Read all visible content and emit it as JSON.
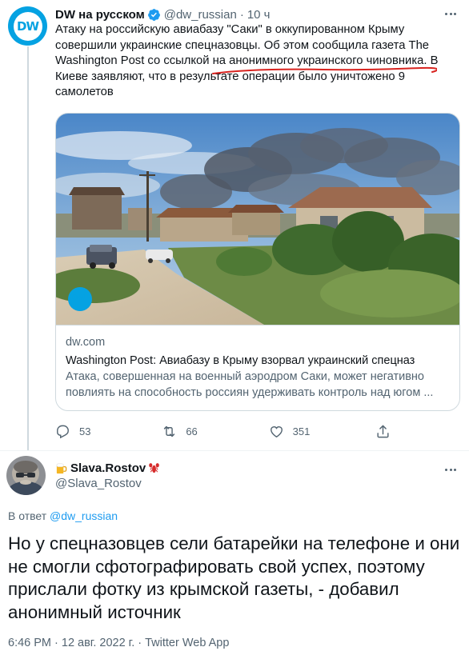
{
  "tweet_main": {
    "author_name": "DW на русском",
    "handle": "@dw_russian",
    "separator": "·",
    "time": "10 ч",
    "avatar_logo": "DW",
    "text": "Атаку на российскую авиабазу \"Саки\" в оккупированном Крыму совершили украинские спецназовцы. Об этом сообщила газета The Washington Post со ссылкой на анонимного украинского чиновника. В Киеве заявляют, что в результате операции было уничтожено 9 самолетов",
    "card": {
      "logo": "DW",
      "domain": "dw.com",
      "title": "Washington Post: Авиабазу в Крыму взорвал украинский спецназ",
      "description": "Атака, совершенная на военный аэродром Саки, может негативно повлиять на способность россиян удерживать контроль над югом ..."
    },
    "actions": {
      "replies": "53",
      "retweets": "66",
      "likes": "351"
    },
    "icons": [
      "verified-badge-icon",
      "more-icon",
      "reply-icon",
      "retweet-icon",
      "like-icon",
      "share-icon"
    ]
  },
  "tweet_reply": {
    "author_name": "Slava.Rostov",
    "handle": "@Slava_Rostov",
    "reply_prefix": "В ответ",
    "reply_to": "@dw_russian",
    "text": "Но у спецназовцев сели батарейки на телефоне и они не смогли сфотографировать свой успех, поэтому прислали фотку из крымской газеты, - добавил анонимный источник",
    "timestamp": "6:46 PM · 12 авг. 2022 г. · Twitter Web App",
    "icons": [
      "beer-emoji-icon",
      "lobster-emoji-icon",
      "more-icon"
    ]
  },
  "colors": {
    "dw_blue": "#05a2e2",
    "twitter_blue": "#1d9bf0",
    "secondary_text": "#536471",
    "annotation_red": "#d8231f"
  }
}
